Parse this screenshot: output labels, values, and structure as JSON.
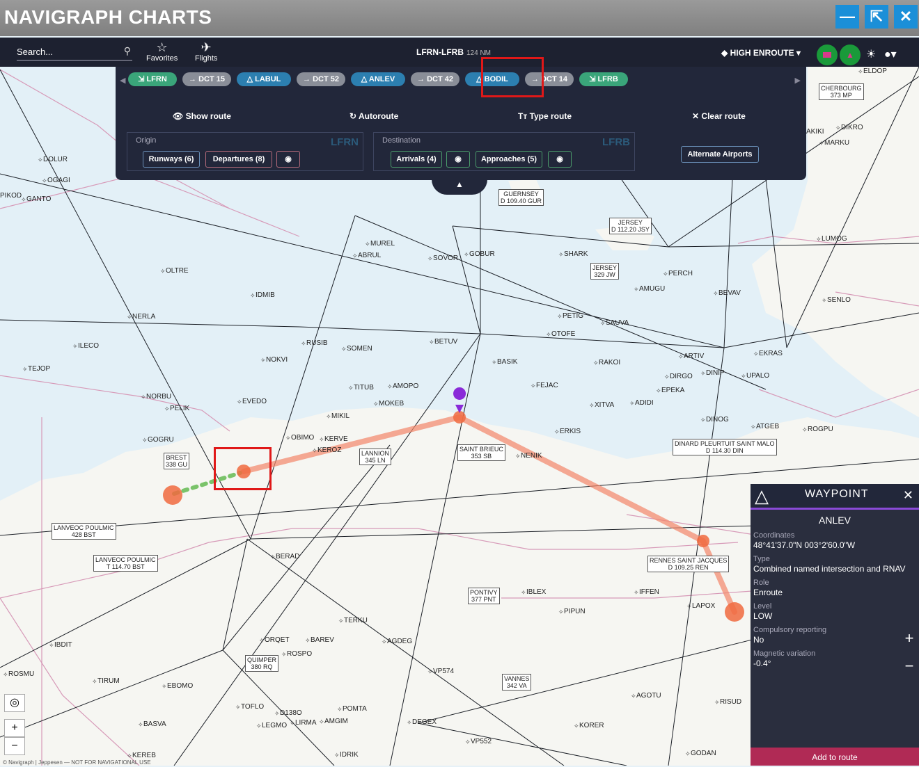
{
  "app": {
    "title": "NAVIGRAPH CHARTS"
  },
  "window": {
    "min": "—",
    "popout": "⇱",
    "close": "✕"
  },
  "nav": {
    "search_placeholder": "Search...",
    "favorites": "Favorites",
    "flights": "Flights",
    "route_title": "LFRN-LFRB",
    "route_distance": "124 NM",
    "layer": "HIGH ENROUTE"
  },
  "route_chips": [
    {
      "kind": "ap",
      "label": "LFRN"
    },
    {
      "kind": "dct",
      "label": "DCT",
      "num": "15"
    },
    {
      "kind": "wp",
      "label": "LABUL"
    },
    {
      "kind": "dct",
      "label": "DCT",
      "num": "52"
    },
    {
      "kind": "wp",
      "label": "ANLEV"
    },
    {
      "kind": "dct",
      "label": "DCT",
      "num": "42"
    },
    {
      "kind": "wp",
      "label": "BODIL"
    },
    {
      "kind": "dct",
      "label": "DCT",
      "num": "14"
    },
    {
      "kind": "ap",
      "label": "LFRB"
    }
  ],
  "actions": {
    "show": "Show route",
    "autoroute": "Autoroute",
    "type": "Type route",
    "clear": "Clear route"
  },
  "origin": {
    "label": "Origin",
    "code": "LFRN",
    "runways": "Runways (6)",
    "departures": "Departures (8)"
  },
  "destination": {
    "label": "Destination",
    "code": "LFRB",
    "arrivals": "Arrivals (4)",
    "approaches": "Approaches (5)"
  },
  "alternate": "Alternate Airports",
  "waypoint": {
    "header": "WAYPOINT",
    "name": "ANLEV",
    "coords_label": "Coordinates",
    "coords": "48°41'37.0\"N  003°2'60.0\"W",
    "type_label": "Type",
    "type": "Combined named intersection and RNAV",
    "role_label": "Role",
    "role": "Enroute",
    "level_label": "Level",
    "level": "LOW",
    "compulsory_label": "Compulsory reporting",
    "compulsory": "No",
    "magvar_label": "Magnetic variation",
    "magvar": "-0.4°",
    "add": "Add to route"
  },
  "map_boxes": [
    {
      "t": "GUERNSEY",
      "s": "D 109.40 GUR"
    },
    {
      "t": "JERSEY",
      "s": "D 112.20 JSY"
    },
    {
      "t": "JERSEY",
      "s": "329 JW"
    },
    {
      "t": "CHERBOURG",
      "s": "373 MP"
    },
    {
      "t": "BREST",
      "s": "338 GU"
    },
    {
      "t": "LANNION",
      "s": "345 LN"
    },
    {
      "t": "SAINT BRIEUC",
      "s": "353 SB"
    },
    {
      "t": "DINARD PLEURTUIT SAINT MALO",
      "s": "D 114.30 DIN"
    },
    {
      "t": "LANVEOC POULMIC",
      "s": "428 BST"
    },
    {
      "t": "LANVEOC POULMIC",
      "s": "T 114.70 BST"
    },
    {
      "t": "RENNES SAINT JACQUES",
      "s": "D 109.25 REN"
    },
    {
      "t": "PONTIVY",
      "s": "377 PNT"
    },
    {
      "t": "QUIMPER",
      "s": "380 RQ"
    },
    {
      "t": "VANNES",
      "s": "342 VA"
    }
  ],
  "map_labels": [
    "DOLUR",
    "OGAGI",
    "GANTO",
    "PIKOD",
    "OLTRE",
    "IDMIB",
    "NERLA",
    "ILECO",
    "TEJOP",
    "NORBU",
    "PELIK",
    "GOGRU",
    "EVEDO",
    "NOKVI",
    "RUSIB",
    "SOMEN",
    "TITUB",
    "AMOPO",
    "MOKEB",
    "MIKIL",
    "OBIMO",
    "KERVE",
    "KEROZ",
    "BETUV",
    "BASIK",
    "FEJAC",
    "XITVA",
    "ADIDI",
    "DIRGO",
    "EPEKA",
    "DINOG",
    "ATGEB",
    "ROGPU",
    "ERKIS",
    "NENIK",
    "MUREL",
    "ABRUL",
    "SOVOR",
    "GOBUR",
    "SHARK",
    "PETIG",
    "SAUVA",
    "OTOFE",
    "RAKOI",
    "ARTIV",
    "DINIP",
    "UPALO",
    "EKRAS",
    "PERCH",
    "AMUGU",
    "BEVAV",
    "SENLO",
    "LUMOG",
    "AKIKI",
    "DIKRO",
    "MARKU",
    "ELDOP",
    "BERAD",
    "TERKU",
    "IBLEX",
    "IFFEN",
    "PIPUN",
    "LAPOX",
    "AGDEG",
    "VP574",
    "IBDIT",
    "ORQET",
    "BAREV",
    "ROSPO",
    "ROSMU",
    "TIRUM",
    "EBOMO",
    "TOFLO",
    "D138O",
    "LEGMO",
    "LIRMA",
    "AMGIM",
    "POMTA",
    "DEGEX",
    "VP552",
    "KORER",
    "AGOTU",
    "RISUD",
    "GODAN",
    "BASVA",
    "KEREB",
    "IDRIK"
  ],
  "colors": {
    "accent": "#1b8fd8",
    "panel": "#22273a",
    "route": "#f4866a",
    "selected": "#e01818"
  },
  "copyright": "© Navigraph | Jeppesen — NOT FOR NAVIGATIONAL USE"
}
